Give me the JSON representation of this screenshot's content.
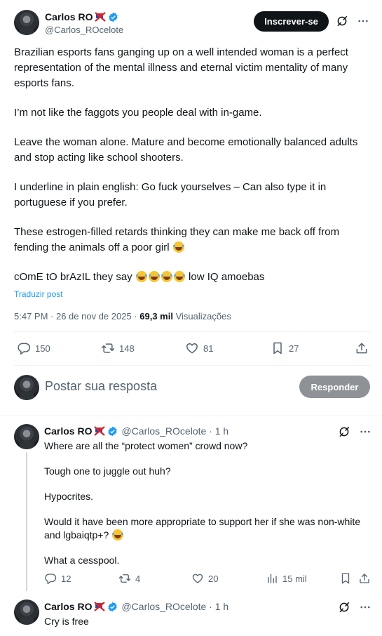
{
  "main_tweet": {
    "author_name": "Carlos RO",
    "handle": "@Carlos_ROcelote",
    "subscribe_label": "Inscrever-se",
    "paragraphs": [
      "Brazilian esports fans ganging up on a well intended woman is a perfect representation of the mental illness and eternal victim mentality of many esports fans.",
      "I’m not like the faggots you people deal with in-game.",
      "Leave the woman alone. Mature and become emotionally balanced adults and stop acting like school shooters.",
      "I underline in plain english: Go fuck yourselves – Can also type it in portuguese if you prefer.",
      "These estrogen-filled retards thinking they can make me back off from fending the animals off a poor girl"
    ],
    "last_line_start": "cOmE tO brAzIL they say",
    "last_line_end": "low IQ amoebas",
    "translate_label": "Traduzir post",
    "timestamp": "5:47 PM · 26 de nov de 2025 ·",
    "views_count": "69,3 mil",
    "views_label": "Visualizações",
    "stats": {
      "replies": "150",
      "reposts": "148",
      "likes": "81",
      "bookmarks": "27"
    }
  },
  "composer": {
    "placeholder": "Postar sua resposta",
    "reply_button": "Responder"
  },
  "replies": [
    {
      "author_name": "Carlos RO",
      "handle_time": "@Carlos_ROcelote · 1 h",
      "paragraphs": [
        "Where are all the “protect women” crowd now?",
        "Tough one to juggle out huh?",
        "Hypocrites.",
        "Would it have been more appropriate to support her if she was non-white and lgbaiqtp+?",
        "What a cesspool."
      ],
      "stats": {
        "replies": "12",
        "reposts": "4",
        "likes": "20",
        "views": "15 mil"
      }
    },
    {
      "author_name": "Carlos RO",
      "handle_time": "@Carlos_ROcelote · 1 h",
      "paragraphs": [
        "Cry is free"
      ]
    }
  ],
  "icons": {
    "verified": "verified-badge-icon",
    "flag": "crossed-flag-icon",
    "grok": "grok-icon",
    "more": "more-dots-icon",
    "reply": "reply-icon",
    "repost": "repost-icon",
    "like": "heart-icon",
    "bookmark": "bookmark-icon",
    "share": "share-icon",
    "views": "views-icon"
  },
  "colors": {
    "accent": "#1d9bf0",
    "text": "#0f1419",
    "muted": "#536471",
    "subscribe_bg": "#0f1419",
    "reply_btn_bg": "#8e9297"
  }
}
